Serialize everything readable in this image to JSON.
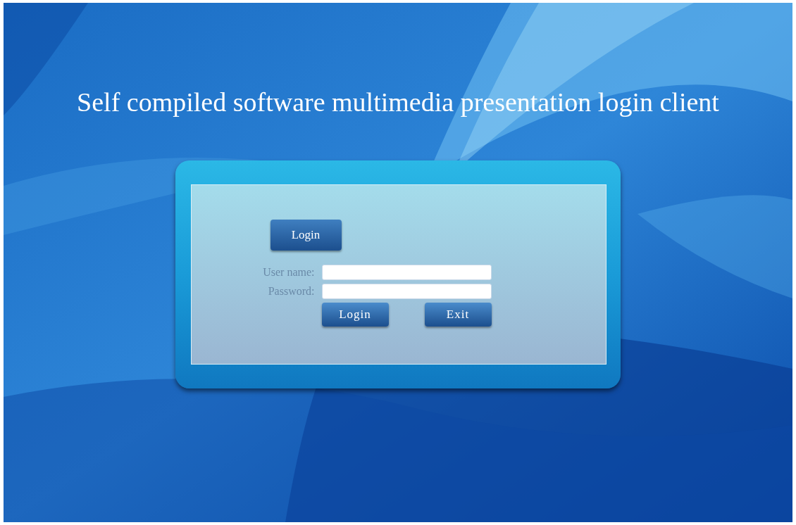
{
  "title": "Self compiled software multimedia presentation login client",
  "login_panel": {
    "header_button": "Login",
    "fields": [
      {
        "label": "User name:"
      },
      {
        "label": "Password:"
      }
    ],
    "buttons": [
      "Login",
      "Exit"
    ]
  }
}
